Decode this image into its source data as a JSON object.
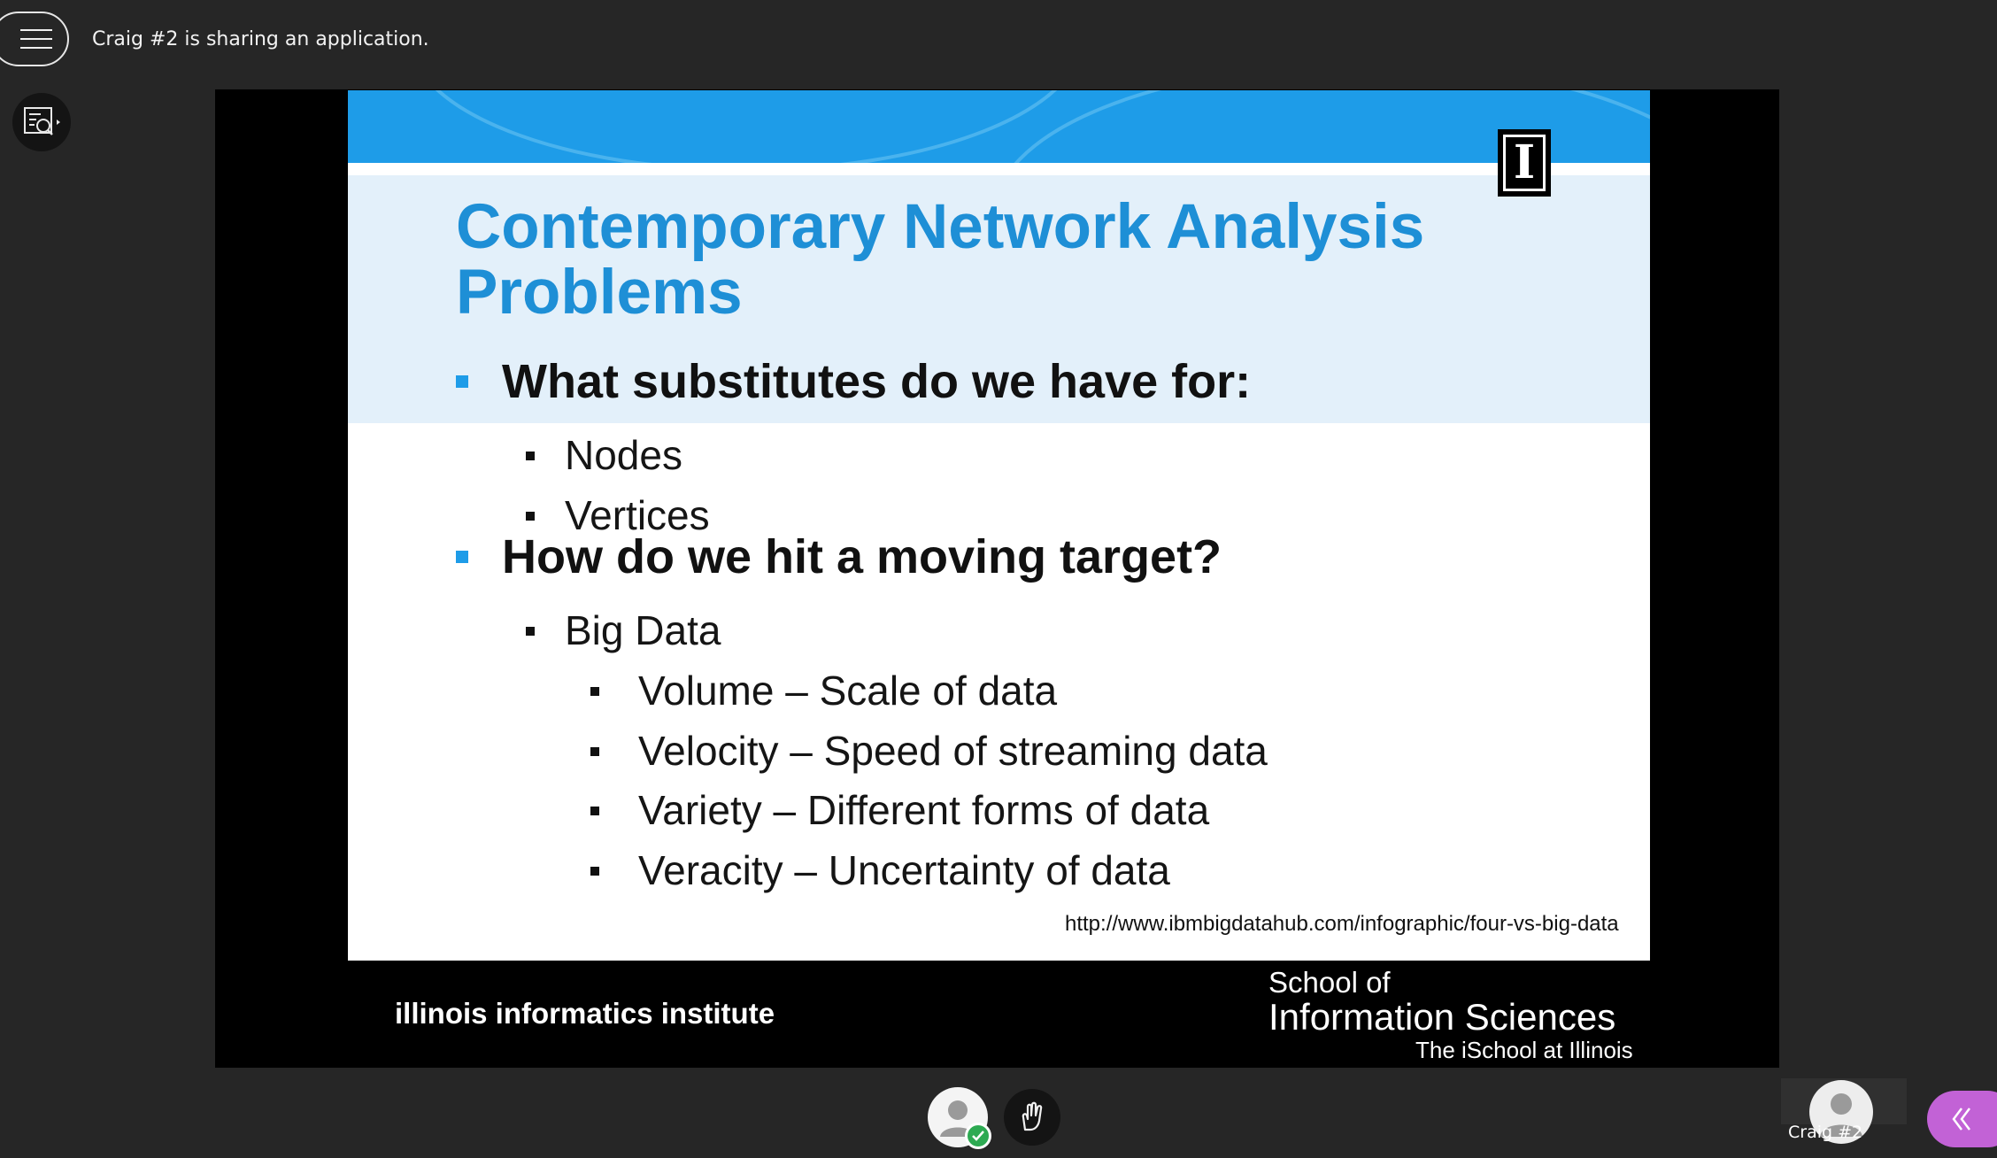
{
  "session": {
    "status_text": "Craig #2 is sharing an application."
  },
  "slide": {
    "title": "Contemporary Network Analysis Problems",
    "bullets": [
      {
        "text": "What substitutes do we have for:",
        "children": [
          {
            "text": "Nodes"
          },
          {
            "text": "Vertices"
          }
        ]
      },
      {
        "text": "How do we hit a moving target?",
        "children": [
          {
            "text": "Big Data",
            "children": [
              {
                "text": "Volume – Scale of data"
              },
              {
                "text": "Velocity – Speed of streaming data"
              },
              {
                "text": "Variety – Different forms of data"
              },
              {
                "text": "Veracity – Uncertainty of data"
              }
            ]
          }
        ]
      }
    ],
    "source_url": "http://www.ibmbigdatahub.com/infographic/four-vs-big-data",
    "logo_letter": "I",
    "footer_left": "illinois informatics institute",
    "footer_right_line1": "School of",
    "footer_right_line2": "Information Sciences",
    "footer_right_line3": "The iSchool at Illinois",
    "colors": {
      "accent_blue": "#1e9ce8",
      "title_blue": "#1e8fd6",
      "title_band": "#e3f0fa"
    }
  },
  "controls": {
    "menu_icon": "hamburger-icon",
    "inspect_icon": "slide-inspect-icon",
    "my_status_icon": "avatar-with-check-icon",
    "raise_hand_icon": "raise-hand-icon",
    "collapse_icon": "double-chevron-left-icon"
  },
  "participant": {
    "name": "Craig #2"
  },
  "theme": {
    "background": "#262626",
    "stage": "#000000",
    "collapse_button": "#c262d6",
    "status_green": "#2daa52"
  }
}
